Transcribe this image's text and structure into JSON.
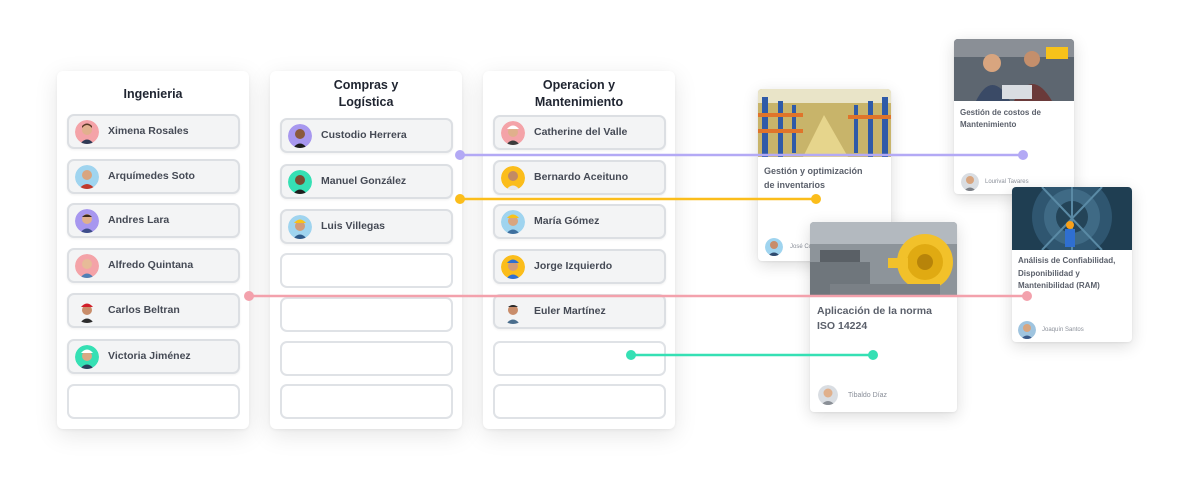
{
  "columns": [
    {
      "title_l1": "Ingenieria",
      "title_l2": "",
      "people": [
        "Ximena Rosales",
        "Arquímedes Soto",
        "Andres Lara",
        "Alfredo Quintana",
        "Carlos Beltran",
        "Victoria Jiménez"
      ]
    },
    {
      "title_l1": "Compras y",
      "title_l2": "Logística",
      "people": [
        "Custodio Herrera",
        "Manuel González",
        "Luis Villegas"
      ]
    },
    {
      "title_l1": "Operacion y",
      "title_l2": "Mantenimiento",
      "people": [
        "Catherine del Valle",
        "Bernardo Aceitu­no",
        "María Gómez",
        "Jorge Izquierdo",
        "Euler Martínez"
      ]
    }
  ],
  "cards": {
    "inventarios": {
      "title_l1": "Gestión y optimización",
      "title_l2": "de inventarios",
      "author": "José Contreras"
    },
    "costos": {
      "title_l1": "Gestión de costos de",
      "title_l2": "Mantenimiento",
      "author": "Lourival Tavares"
    },
    "iso": {
      "title_l1": "Aplicación de la norma",
      "title_l2": "ISO 14224",
      "author": "Tibaldo Díaz"
    },
    "ram": {
      "title_l1": "Análisis de Confiabilidad,",
      "title_l2": "Disponibilidad y",
      "title_l3": "Mantenibilidad (RAM)",
      "author": "Joaquín Santos"
    }
  },
  "colors": {
    "purple": "#b3a9f5",
    "orange": "#fbbd1b",
    "pink": "#f3a1ac",
    "teal": "#35e0b4"
  }
}
